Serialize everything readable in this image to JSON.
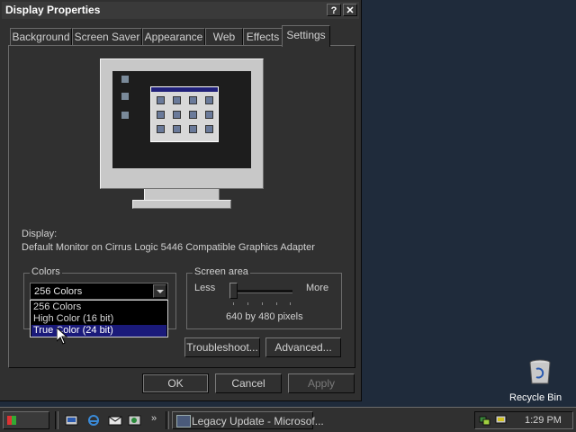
{
  "dialog": {
    "title": "Display Properties",
    "help_glyph": "?",
    "close_glyph": "✕"
  },
  "tabs": [
    {
      "label": "Background"
    },
    {
      "label": "Screen Saver"
    },
    {
      "label": "Appearance"
    },
    {
      "label": "Web"
    },
    {
      "label": "Effects"
    },
    {
      "label": "Settings",
      "active": true
    }
  ],
  "settings": {
    "display_label": "Display:",
    "display_value": "Default Monitor on Cirrus Logic 5446 Compatible Graphics Adapter",
    "colors": {
      "legend": "Colors",
      "selected": "256 Colors",
      "options": [
        "256 Colors",
        "High Color (16 bit)",
        "True Color (24 bit)"
      ],
      "highlighted_index": 2
    },
    "screen_area": {
      "legend": "Screen area",
      "less_label": "Less",
      "more_label": "More",
      "value": "640 by 480 pixels"
    },
    "troubleshoot_label": "Troubleshoot...",
    "advanced_label": "Advanced..."
  },
  "footer": {
    "ok_label": "OK",
    "cancel_label": "Cancel",
    "apply_label": "Apply"
  },
  "desktop": {
    "recycle_bin_label": "Recycle Bin"
  },
  "taskbar": {
    "more_glyph": "»",
    "task_label": "Legacy Update - Microsof...",
    "clock": "1:29 PM"
  },
  "colors": {
    "desktop": "#1f2b3b",
    "dialog_face": "#303030",
    "highlight": "#1a1a7a"
  }
}
